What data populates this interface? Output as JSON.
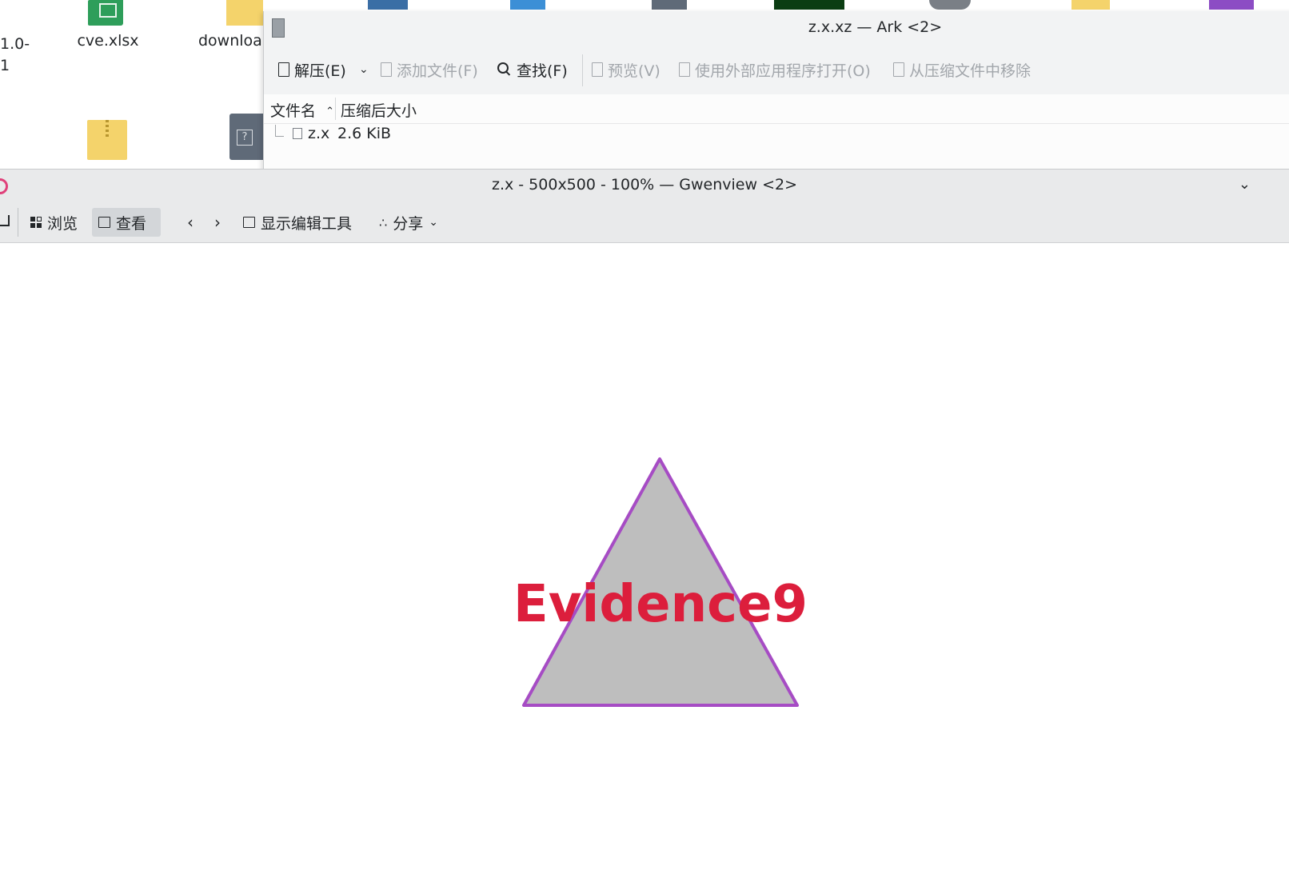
{
  "desktop": {
    "icons": [
      {
        "label_line1": "1.0-",
        "label_line2": "1"
      },
      {
        "label": "cve.xlsx"
      },
      {
        "label": "downloa"
      }
    ]
  },
  "ark": {
    "title": "z.x.xz — Ark <2>",
    "toolbar": {
      "extract": "解压(E)",
      "add_file": "添加文件(F)",
      "find": "查找(F)",
      "preview": "预览(V)",
      "open_external": "使用外部应用程序打开(O)",
      "remove": "从压缩文件中移除"
    },
    "columns": {
      "name": "文件名",
      "size": "压缩后大小"
    },
    "rows": [
      {
        "name": "z.x",
        "size": "2.6 KiB"
      }
    ]
  },
  "gwenview": {
    "title": "z.x - 500x500 - 100% — Gwenview <2>",
    "toolbar": {
      "browse": "浏览",
      "view": "查看",
      "show_edit_tools": "显示编辑工具",
      "share": "分享"
    },
    "image": {
      "text": "Evidence9",
      "text_color": "#dc1e3c",
      "fill_color": "#bebebe",
      "stroke_color": "#a64cc4"
    }
  },
  "colors": {
    "accent": "#3daee9",
    "disabled_text": "#a2a6ab"
  }
}
